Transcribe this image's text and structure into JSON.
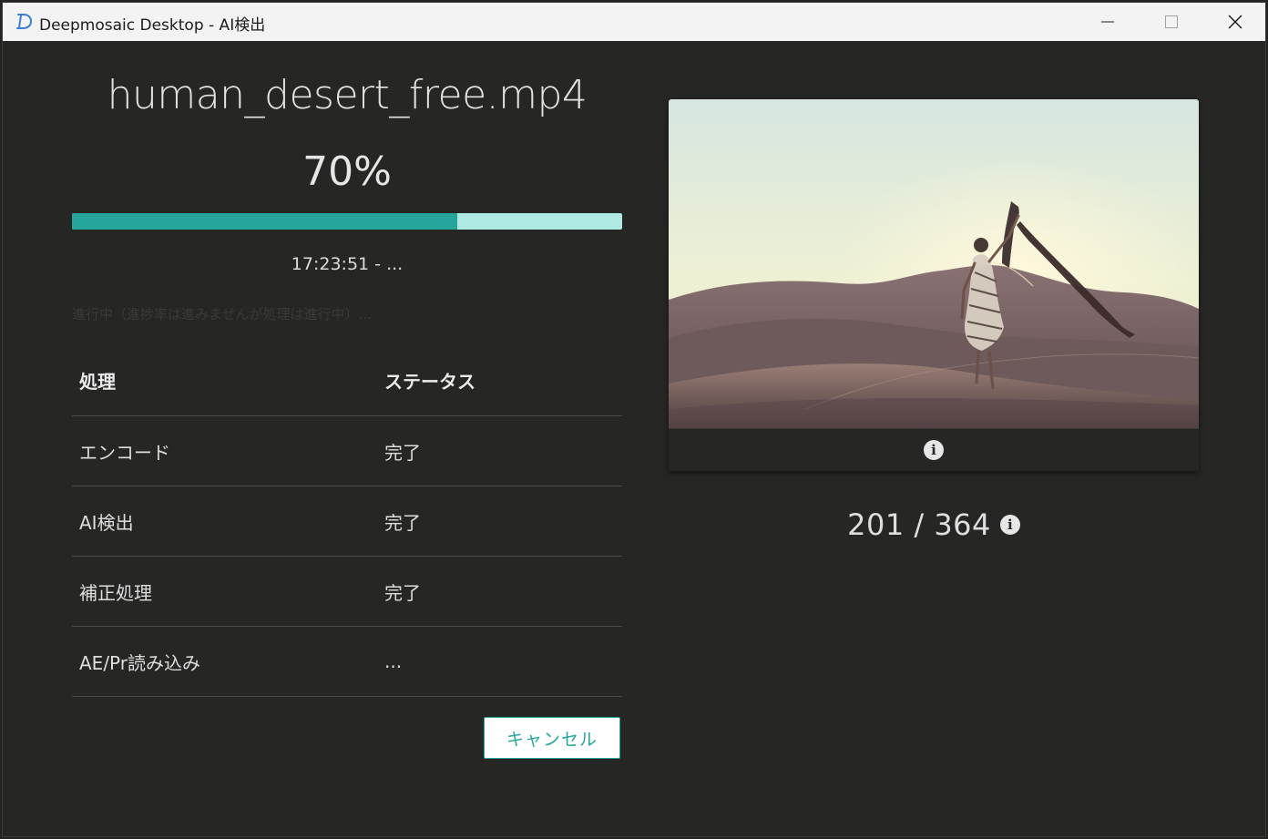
{
  "window": {
    "title": "Deepmosaic Desktop - AI検出"
  },
  "job": {
    "filename": "human_desert_free.mp4",
    "progress_label": "70%",
    "progress_fraction": 0.7,
    "time_text": "17:23:51 - ...",
    "faint_status": "進行中（進捗率は進みませんが処理は進行中）..."
  },
  "table": {
    "headers": {
      "process": "処理",
      "status": "ステータス"
    },
    "rows": [
      {
        "process": "エンコード",
        "status": "完了"
      },
      {
        "process": "AI検出",
        "status": "完了"
      },
      {
        "process": "補正処理",
        "status": "完了"
      },
      {
        "process": "AE/Pr読み込み",
        "status": "..."
      }
    ]
  },
  "actions": {
    "cancel_label": "キャンセル"
  },
  "preview": {
    "frame_counter": "201 / 364"
  },
  "colors": {
    "accent": "#26a69a",
    "progress_track": "#aee9e4",
    "background": "#262624"
  }
}
